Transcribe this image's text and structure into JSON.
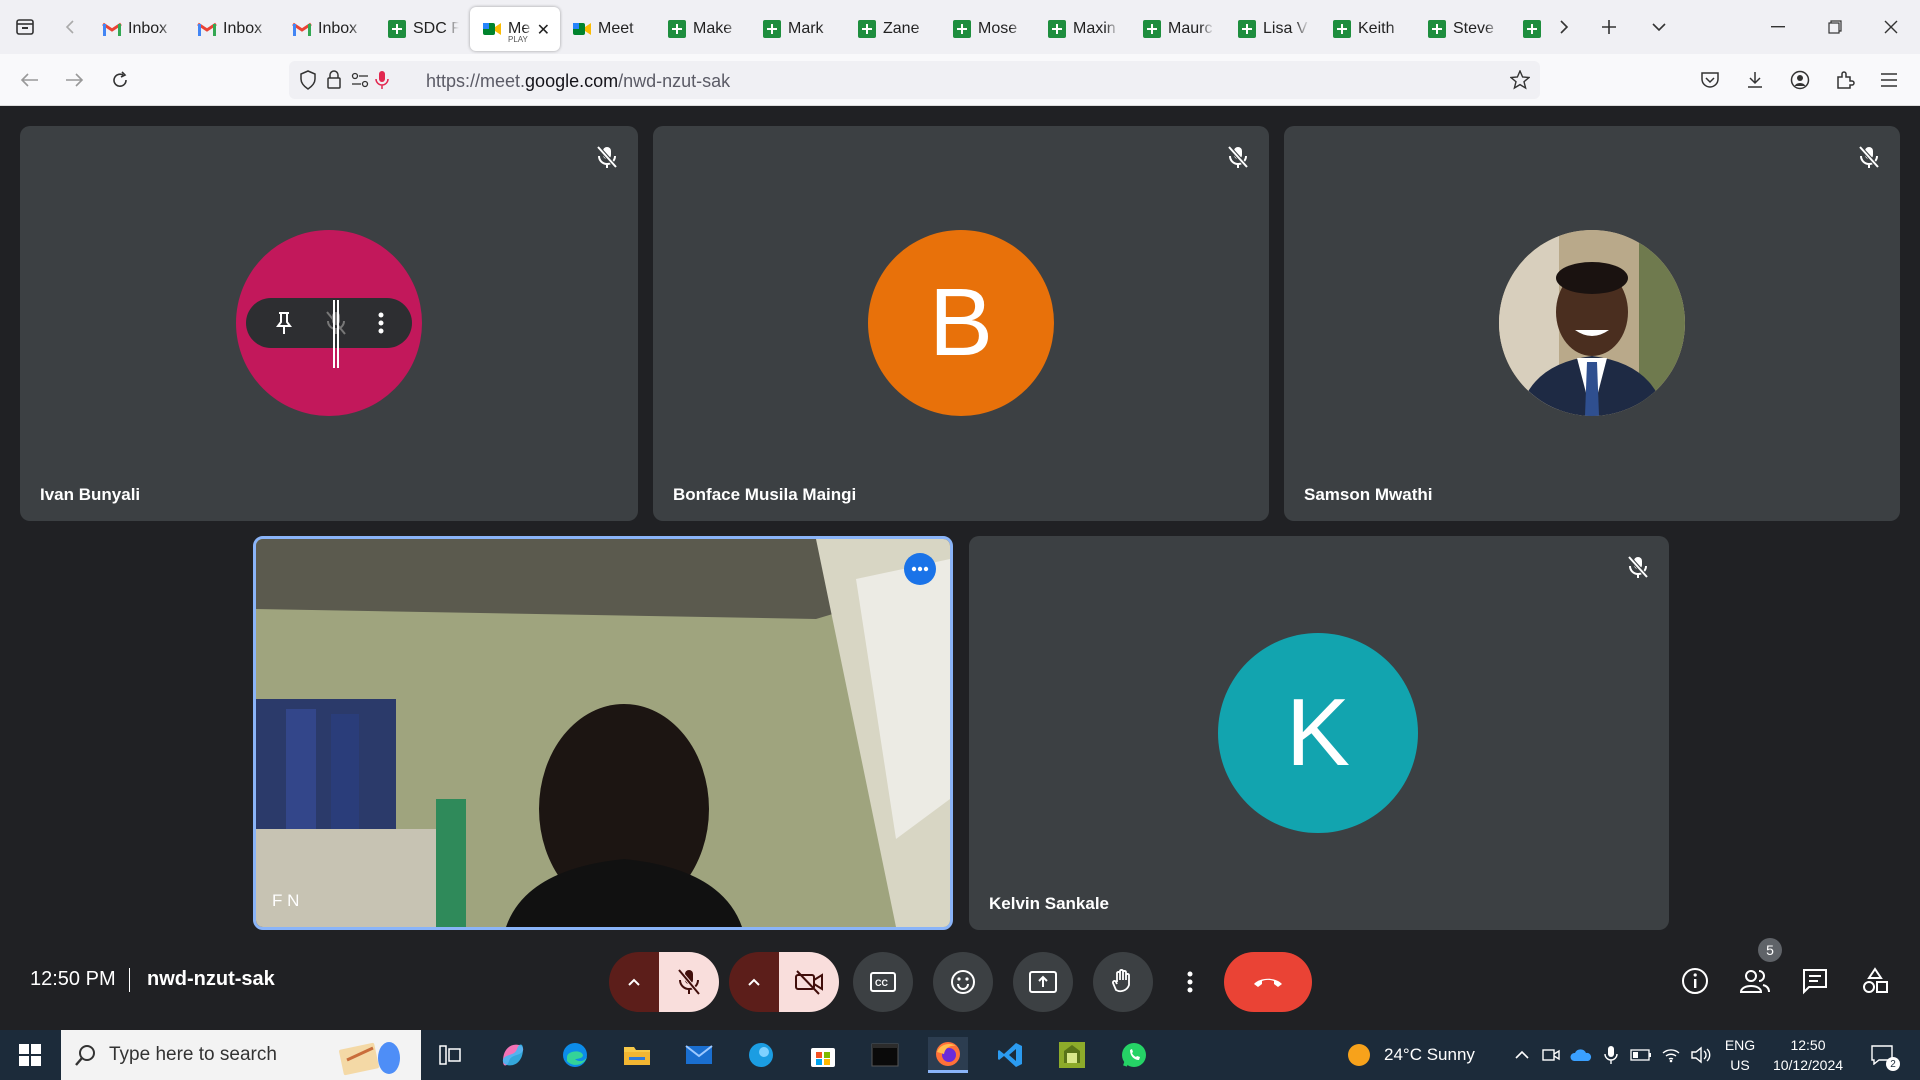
{
  "browser": {
    "tabs": [
      {
        "label": "Inbox",
        "icon": "gmail-icon"
      },
      {
        "label": "Inbox",
        "icon": "gmail-icon"
      },
      {
        "label": "Inbox",
        "icon": "gmail-icon"
      },
      {
        "label": "SDC F",
        "icon": "sheets-icon"
      },
      {
        "label": "Me",
        "sublabel": "PLAY",
        "icon": "meet-icon",
        "active": true
      },
      {
        "label": "Meet",
        "icon": "meet-icon"
      },
      {
        "label": "Make",
        "icon": "sheets-icon"
      },
      {
        "label": "Mark",
        "icon": "sheets-icon"
      },
      {
        "label": "Zane",
        "icon": "sheets-icon"
      },
      {
        "label": "Mose",
        "icon": "sheets-icon"
      },
      {
        "label": "Maxin",
        "icon": "sheets-icon"
      },
      {
        "label": "Maurc",
        "icon": "sheets-icon"
      },
      {
        "label": "Lisa V",
        "icon": "sheets-icon"
      },
      {
        "label": "Keith",
        "icon": "sheets-icon"
      },
      {
        "label": "Steve",
        "icon": "sheets-icon"
      }
    ],
    "url_prefix": "https://meet.",
    "url_domain": "google.com",
    "url_path": "/nwd-nzut-sak"
  },
  "meeting": {
    "participants": [
      {
        "name": "Ivan Bunyali",
        "avatar_color": "#c2185b",
        "muted": true
      },
      {
        "name": "Bonface Musila Maingi",
        "initial": "B",
        "avatar_color": "#e8710a",
        "muted": true
      },
      {
        "name": "Samson Mwathi",
        "avatar": "photo",
        "muted": true
      },
      {
        "name": "F N",
        "self": true,
        "video_on": true
      },
      {
        "name": "Kelvin Sankale",
        "initial": "K",
        "avatar_color": "#12a4af",
        "muted": true
      }
    ],
    "time": "12:50 PM",
    "code": "nwd-nzut-sak",
    "people_count": "5",
    "end_call_color": "#ea4335"
  },
  "taskbar": {
    "search_placeholder": "Type here to search",
    "weather": "24°C  Sunny",
    "lang_top": "ENG",
    "lang_bottom": "US",
    "clock_time": "12:50",
    "clock_date": "10/12/2024",
    "notif_count": "2"
  }
}
